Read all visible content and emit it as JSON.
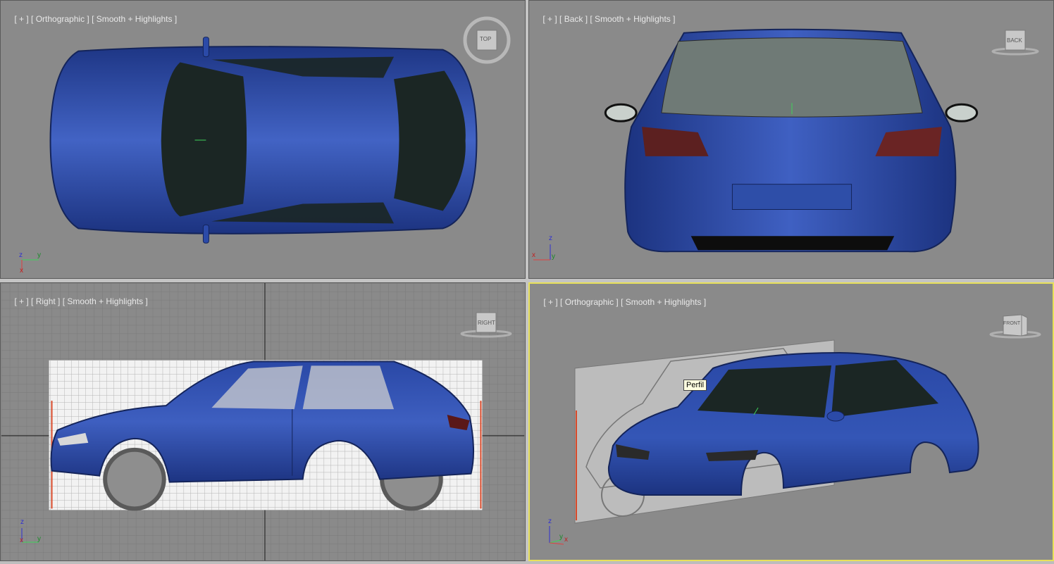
{
  "viewports": {
    "top_left": {
      "label": {
        "plus": "[ + ]",
        "view": "[ Orthographic ]",
        "shading": "[ Smooth + Highlights ]"
      },
      "viewcube": "TOP",
      "axes": {
        "a": "z",
        "b": "y",
        "c": "x"
      }
    },
    "top_right": {
      "label": {
        "plus": "[ + ]",
        "view": "[ Back ]",
        "shading": "[ Smooth + Highlights ]"
      },
      "viewcube": "BACK",
      "axes": {
        "a": "z",
        "b": "y",
        "c": "x"
      }
    },
    "bottom_left": {
      "label": {
        "plus": "[ + ]",
        "view": "[ Right ]",
        "shading": "[ Smooth + Highlights ]"
      },
      "viewcube": "RIGHT",
      "axes": {
        "a": "z",
        "b": "y",
        "c": "x"
      }
    },
    "bottom_right": {
      "label": {
        "plus": "[ + ]",
        "view": "[ Orthographic ]",
        "shading": "[ Smooth + Highlights ]"
      },
      "viewcube": "FRONT",
      "axes": {
        "a": "z",
        "b": "y",
        "c": "x"
      },
      "tooltip": "Perfil"
    }
  },
  "colors": {
    "viewport_bg": "#8a8a8a",
    "car_blue": "#2b4aa8",
    "glass": "#1b2624",
    "active_border": "#e8e15a"
  }
}
